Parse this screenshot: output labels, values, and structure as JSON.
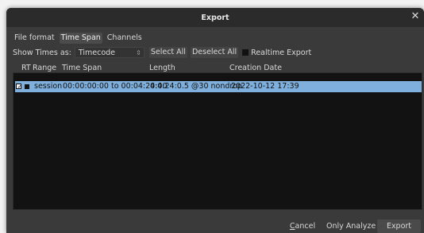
{
  "window": {
    "title": "Export"
  },
  "tabs": [
    {
      "label": "File format",
      "active": false
    },
    {
      "label": "Time Span",
      "active": true
    },
    {
      "label": "Channels",
      "active": false
    }
  ],
  "options": {
    "show_times_label": "Show Times as:",
    "time_format_value": "Timecode",
    "select_all": "Select All",
    "deselect_all": "Deselect All",
    "realtime_export": "Realtime Export"
  },
  "table": {
    "headers": [
      "RT",
      "Range",
      "Time Span",
      "Length",
      "Creation Date"
    ],
    "rows": [
      {
        "selected": true,
        "checked": true,
        "name": "session",
        "time_span": "00:00:00:00 to 00:04:24:00",
        "length": "0:4:24:0.5 @30 nondrop",
        "creation_date": "2022-10-12 17:39"
      }
    ]
  },
  "buttons": {
    "cancel_first": "C",
    "cancel_rest": "ancel",
    "only_analyze": "Only Analyze",
    "export": "Export"
  },
  "colors": {
    "dialog_bg": "#3a3a3a",
    "titlebar_bg": "#2b2b2b",
    "list_bg": "#121212",
    "selection": "#7fb0dd"
  }
}
